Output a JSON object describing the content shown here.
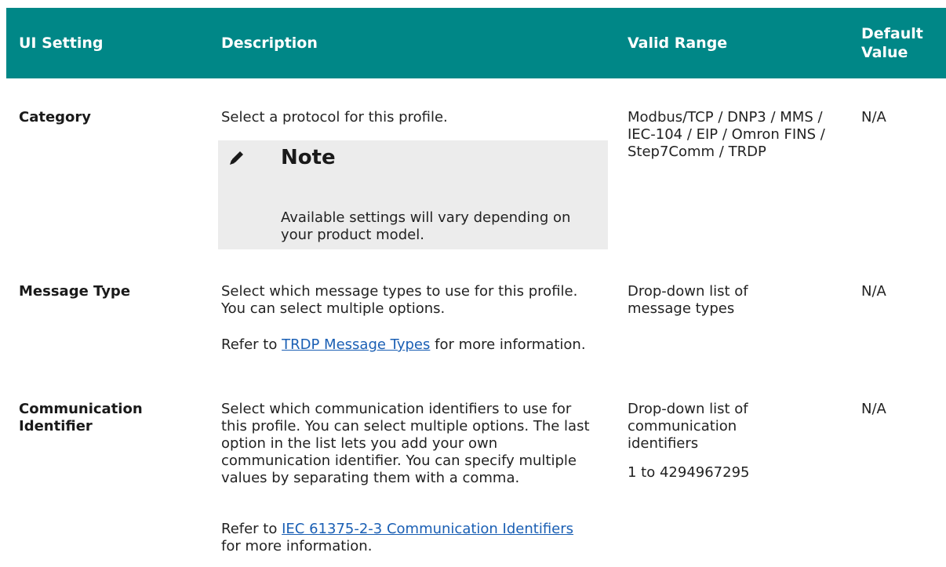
{
  "table": {
    "headers": {
      "ui_setting": "UI Setting",
      "description": "Description",
      "valid_range": "Valid Range",
      "default_value": "Default Value"
    },
    "rows": [
      {
        "setting": "Category",
        "description": "Select a protocol for this profile.",
        "note": {
          "icon": "pencil-icon",
          "title": "Note",
          "body": "Available settings will vary depending on your product model."
        },
        "valid_range": "Modbus/TCP / DNP3 / MMS / IEC-104 / EIP / Omron FINS / Step7Comm / TRDP",
        "default": "N/A"
      },
      {
        "setting": "Message Type",
        "description": "Select which message types to use for this profile. You can select multiple options.",
        "refer_prefix": "Refer to ",
        "refer_link": "TRDP Message Types",
        "refer_suffix": " for more information.",
        "valid_range": "Drop-down list of message types",
        "default": "N/A"
      },
      {
        "setting": "Communication Identifier",
        "description": "Select which communication identifiers to use for this profile. You can select multiple options. The last option in the list lets you add your own communication identifier. You can specify multiple values by separating them with a comma.",
        "refer_prefix": "Refer to ",
        "refer_link": "IEC 61375-2-3 Communication Identifiers",
        "refer_suffix": " for more information.",
        "valid_range": "Drop-down list of communication identifiers",
        "valid_range_extra": "1 to 4294967295",
        "default": "N/A"
      }
    ]
  },
  "colors": {
    "header_bg": "#008787",
    "note_bg": "#ececec",
    "link": "#1a5fb4"
  }
}
